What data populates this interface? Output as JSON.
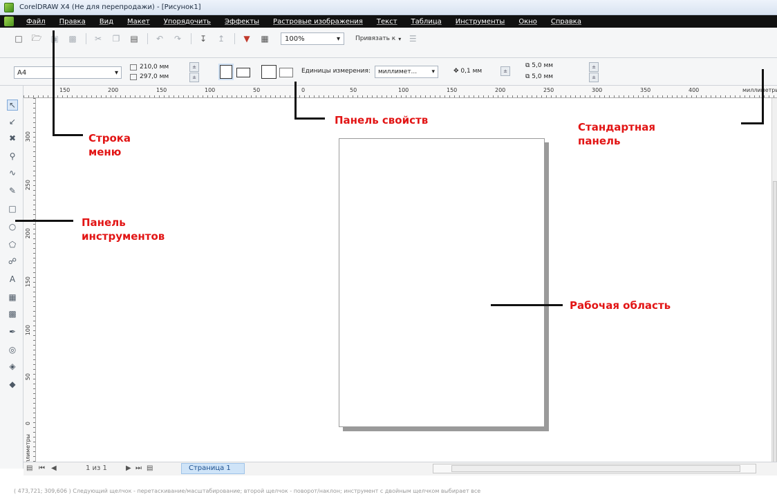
{
  "window": {
    "title": "CorelDRAW X4 (Не для перепродажи) - [Рисунок1]"
  },
  "menu": [
    "Файл",
    "Правка",
    "Вид",
    "Макет",
    "Упорядочить",
    "Эффекты",
    "Растровые изображения",
    "Текст",
    "Таблица",
    "Инструменты",
    "Окно",
    "Справка"
  ],
  "standard_toolbar": {
    "zoom": "100%",
    "snap_label": "Привязать к",
    "icons": [
      "new-icon",
      "open-icon",
      "save-icon",
      "print-icon",
      "cut-icon",
      "copy-icon",
      "paste-icon",
      "undo-icon",
      "redo-icon",
      "import-icon",
      "export-icon",
      "app-launcher-icon",
      "welcome-screen-icon"
    ]
  },
  "property_bar": {
    "page_size": "A4",
    "width": "210,0 мм",
    "height": "297,0 мм",
    "units_label": "Единицы измерения:",
    "units_value": "миллимет...",
    "nudge": "0,1 мм",
    "dup_x": "5,0 мм",
    "dup_y": "5,0 мм"
  },
  "ruler": {
    "units": "миллиметры",
    "h_labels": [
      "150",
      "200",
      "150",
      "100",
      "50",
      "0",
      "50",
      "100",
      "150",
      "200",
      "250",
      "300",
      "350",
      "400"
    ],
    "v_labels": [
      "300",
      "250",
      "200",
      "150",
      "100",
      "50",
      "0"
    ]
  },
  "toolbox": [
    "pick-tool-icon",
    "shape-tool-icon",
    "crop-tool-icon",
    "zoom-tool-icon",
    "freehand-tool-icon",
    "smart-fill-tool-icon",
    "rectangle-tool-icon",
    "ellipse-tool-icon",
    "polygon-tool-icon",
    "basic-shapes-tool-icon",
    "text-tool-icon",
    "table-tool-icon",
    "interactive-blend-tool-icon",
    "eyedropper-tool-icon",
    "outline-tool-icon",
    "fill-tool-icon",
    "interactive-fill-tool-icon"
  ],
  "page_nav": {
    "counter": "1 из 1",
    "page_tab": "Страница 1"
  },
  "status": "( 473,721; 309,606 )   Следующий щелчок - перетаскивание/масштабирование; второй щелчок - поворот/наклон; инструмент с двойным щелчком выбирает все",
  "annotations": {
    "menu_bar": "Строка\nменю",
    "property_bar": "Панель свойств",
    "standard_bar": "Стандартная\nпанель",
    "toolbox": "Панель\nинструментов",
    "workspace": "Рабочая область"
  },
  "colors": {
    "annotation": "#e21515",
    "page_tab": "#cfe4f8"
  }
}
